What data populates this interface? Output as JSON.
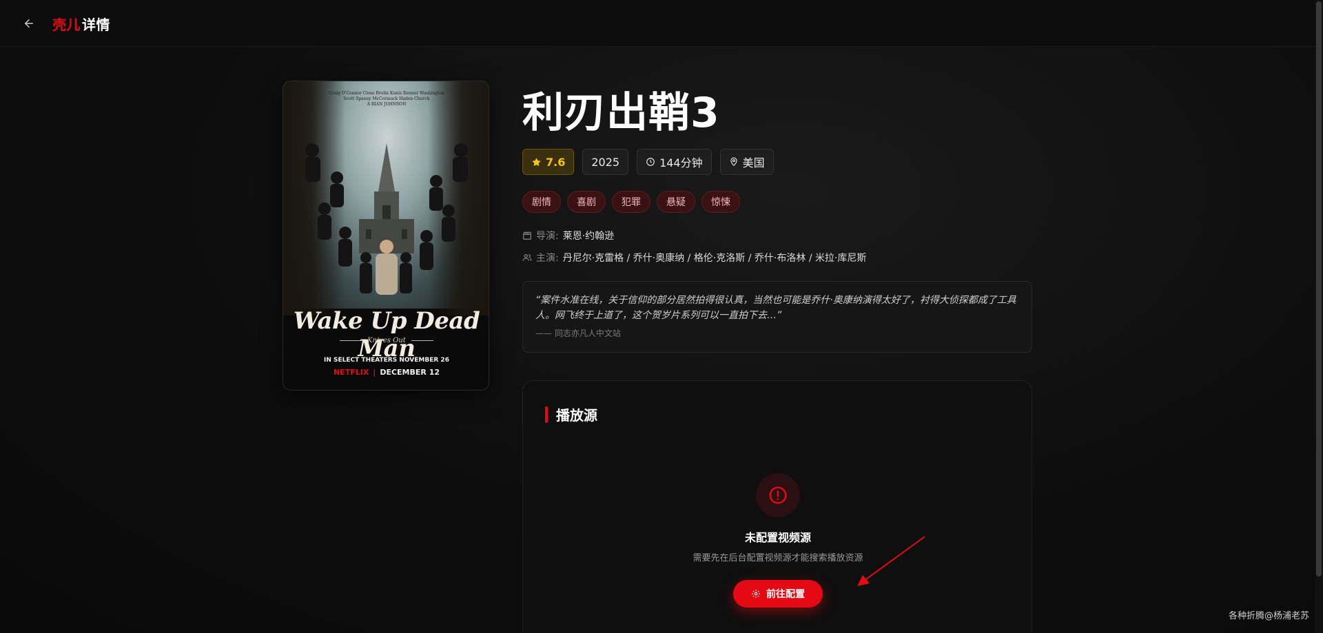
{
  "header": {
    "brand_red": "壳儿",
    "brand_white": "详情"
  },
  "poster": {
    "credits_top": "Craig O'Connor Close Brolin Kunis Renner Washington",
    "credits_mid": "Scott Spaeny McCormack Haden Church",
    "credits_director": "A RIAN JOHNSON",
    "title": "Wake Up Dead Man",
    "subtitle": "Knives Out",
    "theaters": "IN SELECT THEATERS NOVEMBER 26",
    "network": "NETFLIX",
    "separator": "|",
    "release": "DECEMBER 12"
  },
  "movie": {
    "title": "利刃出鞘3",
    "rating": "7.6",
    "year": "2025",
    "duration": "144分钟",
    "country": "美国",
    "genres": [
      "剧情",
      "喜剧",
      "犯罪",
      "悬疑",
      "惊悚"
    ],
    "director_label": "导演:",
    "director": "莱恩·约翰逊",
    "cast_label": "主演:",
    "cast": "丹尼尔·克雷格 / 乔什·奥康纳 / 格伦·克洛斯 / 乔什·布洛林 / 米拉·库尼斯"
  },
  "review": {
    "text": "“案件水准在线，关于信仰的部分居然拍得很认真，当然也可能是乔什·奥康纳演得太好了，衬得大侦探都成了工具人。网飞终于上道了，这个贺岁片系列可以一直拍下去…”",
    "source": "—— 同志亦凡人中文站"
  },
  "sources": {
    "heading": "播放源",
    "empty_title": "未配置视频源",
    "empty_desc": "需要先在后台配置视频源才能搜索播放资源",
    "config_button": "前往配置"
  },
  "watermark": "各种折腾@杨浦老苏",
  "colors": {
    "accent": "#e50914",
    "rating": "#f5c518",
    "background": "#0b0b0b"
  },
  "icons": {
    "back": "arrow-left-icon",
    "rating": "star-icon",
    "duration": "clock-icon",
    "country": "map-pin-icon",
    "director": "clapperboard-icon",
    "cast": "users-icon",
    "empty": "alert-circle-icon",
    "config": "gear-icon"
  }
}
